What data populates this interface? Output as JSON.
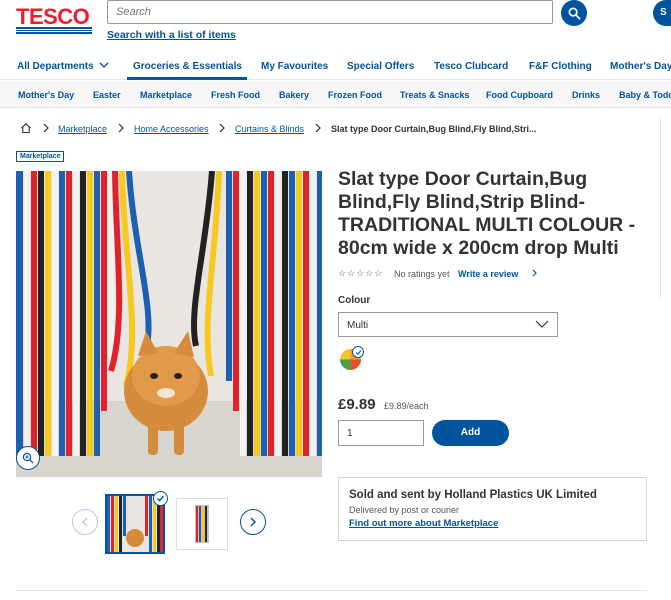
{
  "header": {
    "logo_text": "TESCO",
    "search_placeholder": "Search",
    "search_list_link": "Search with a list of items",
    "top_right_button": "S"
  },
  "nav_primary": {
    "items": [
      {
        "label": "All Departments",
        "has_dropdown": true
      },
      {
        "label": "Groceries & Essentials",
        "active": true
      },
      {
        "label": "My Favourites"
      },
      {
        "label": "Special Offers"
      },
      {
        "label": "Tesco Clubcard"
      },
      {
        "label": "F&F Clothing"
      },
      {
        "label": "Mother's Day"
      }
    ]
  },
  "nav_secondary": {
    "items": [
      {
        "label": "Mother's Day"
      },
      {
        "label": "Easter"
      },
      {
        "label": "Marketplace"
      },
      {
        "label": "Fresh Food"
      },
      {
        "label": "Bakery"
      },
      {
        "label": "Frozen Food"
      },
      {
        "label": "Treats & Snacks"
      },
      {
        "label": "Food Cupboard"
      },
      {
        "label": "Drinks"
      },
      {
        "label": "Baby & Toddl"
      }
    ]
  },
  "breadcrumb": {
    "items": [
      {
        "label": "Marketplace"
      },
      {
        "label": "Home Accessories"
      },
      {
        "label": "Curtains & Blinds"
      }
    ],
    "current": "Slat type Door Curtain,Bug Blind,Fly Blind,Stri..."
  },
  "product": {
    "badge": "Marketplace",
    "title": "Slat type Door Curtain,Bug Blind,Fly Blind,Strip Blind-TRADITIONAL MULTI COLOUR - 80cm wide x 200cm drop Multi",
    "rating_stars": "☆☆☆☆☆",
    "rating_text": "No ratings yet",
    "write_review": "Write a review",
    "colour_label": "Colour",
    "colour_selected": "Multi",
    "price": "£9.89",
    "unit_price": "£9.89/each",
    "quantity": "1",
    "add_button": "Add"
  },
  "seller": {
    "title": "Sold and sent by Holland Plastics UK Limited",
    "delivery": "Delivered by post or courier",
    "link": "Find out more about Marketplace"
  },
  "colors": {
    "tesco_blue": "#00539f",
    "tesco_red": "#ee1c2e"
  }
}
